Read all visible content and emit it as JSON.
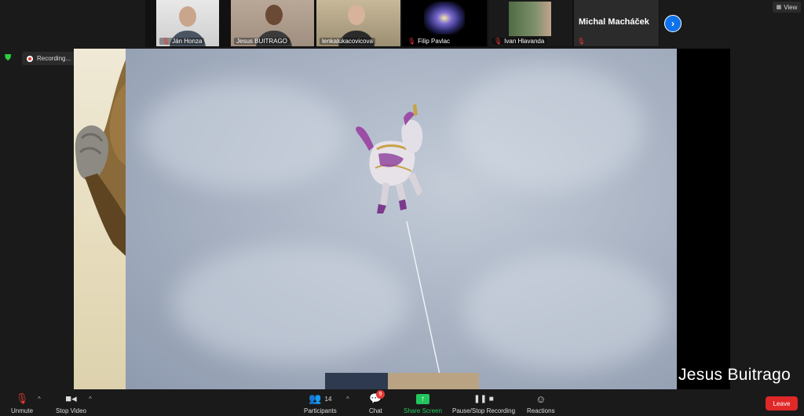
{
  "gallery": {
    "participants": [
      {
        "name": "Ján Honza",
        "muted": true
      },
      {
        "name": "Jesus BUITRAGO",
        "muted": false
      },
      {
        "name": "lenkalukacovicova",
        "muted": false
      },
      {
        "name": "Filip Pavlac",
        "muted": true
      },
      {
        "name": "Ivan Hlavanda",
        "muted": true
      }
    ],
    "name_only_tile": "Michal Macháček",
    "next_arrow": "›"
  },
  "view_button": {
    "label": "View"
  },
  "recording": {
    "label": "Recording..."
  },
  "active_speaker": "Jesus Buitrago",
  "toolbar": {
    "unmute": "Unmute",
    "stop_video": "Stop Video",
    "participants": "Participants",
    "participants_count": "14",
    "chat": "Chat",
    "chat_badge": "9",
    "share_screen": "Share Screen",
    "pause_stop_recording": "Pause/Stop Recording",
    "reactions": "Reactions",
    "leave": "Leave"
  },
  "colors": {
    "accent_blue": "#0e72ed",
    "share_green": "#23c55e",
    "leave_red": "#e02828",
    "muted_red": "#e53935"
  }
}
